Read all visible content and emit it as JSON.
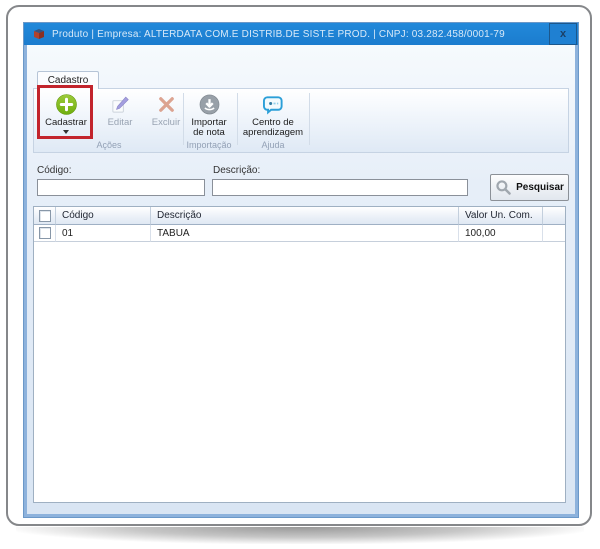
{
  "titlebar": {
    "title": "Produto | Empresa: ALTERDATA COM.E DISTRIB.DE SIST.E PROD. | CNPJ: 03.282.458/0001-79",
    "close": "x"
  },
  "tabs": {
    "cadastro": "Cadastro"
  },
  "ribbon": {
    "cadastrar": {
      "label": "Cadastrar"
    },
    "editar": {
      "label": "Editar"
    },
    "excluir": {
      "label": "Excluir"
    },
    "importar": {
      "line1": "Importar",
      "line2": "de nota"
    },
    "centro": {
      "line1": "Centro de",
      "line2": "aprendizagem"
    },
    "groups": {
      "acoes": "Ações",
      "importacao": "Importação",
      "ajuda": "Ajuda"
    }
  },
  "search": {
    "codigo_label": "Código:",
    "descricao_label": "Descrição:",
    "codigo_value": "",
    "descricao_value": "",
    "pesquisar_label": "Pesquisar"
  },
  "table": {
    "headers": {
      "codigo": "Código",
      "descricao": "Descrição",
      "valor": "Valor Un. Com."
    },
    "rows": [
      {
        "codigo": "01",
        "descricao": "TABUA",
        "valor": "100,00"
      }
    ]
  },
  "colors": {
    "titlebar_blue": "#1e82d5",
    "add_green": "#7db41c",
    "highlight_red": "#c2242c",
    "learning_blue": "#2b9fd8",
    "delete_red": "#d68f77",
    "import_gray": "#98a0a8"
  }
}
